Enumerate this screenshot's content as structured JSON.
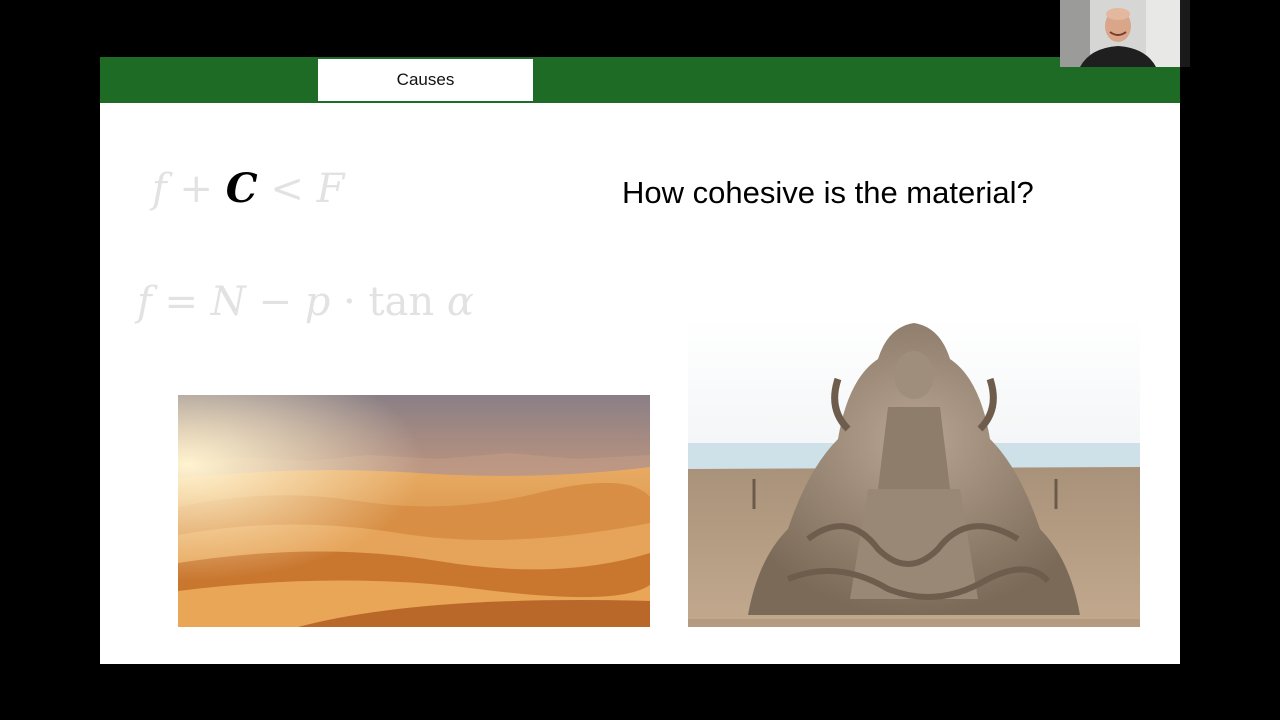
{
  "header": {
    "section_tab_label": "Causes"
  },
  "formulas": {
    "first": {
      "f": "f",
      "plus": "+",
      "C": "C",
      "lt": "<",
      "F": "F"
    },
    "second": {
      "f": "f",
      "eq": "=",
      "N": "N",
      "minus": "−",
      "p": "p",
      "dot": "·",
      "tan": "tan",
      "alpha": "α"
    }
  },
  "question": "How cohesive is the material?",
  "images": {
    "left": "desert-dunes-photo",
    "right": "sand-sculpture-photo"
  },
  "webcam": {
    "subject": "presenter-video"
  },
  "colors": {
    "header_green": "#1e6b26",
    "formula_faded": "#e2e2e2",
    "background": "#000000"
  }
}
